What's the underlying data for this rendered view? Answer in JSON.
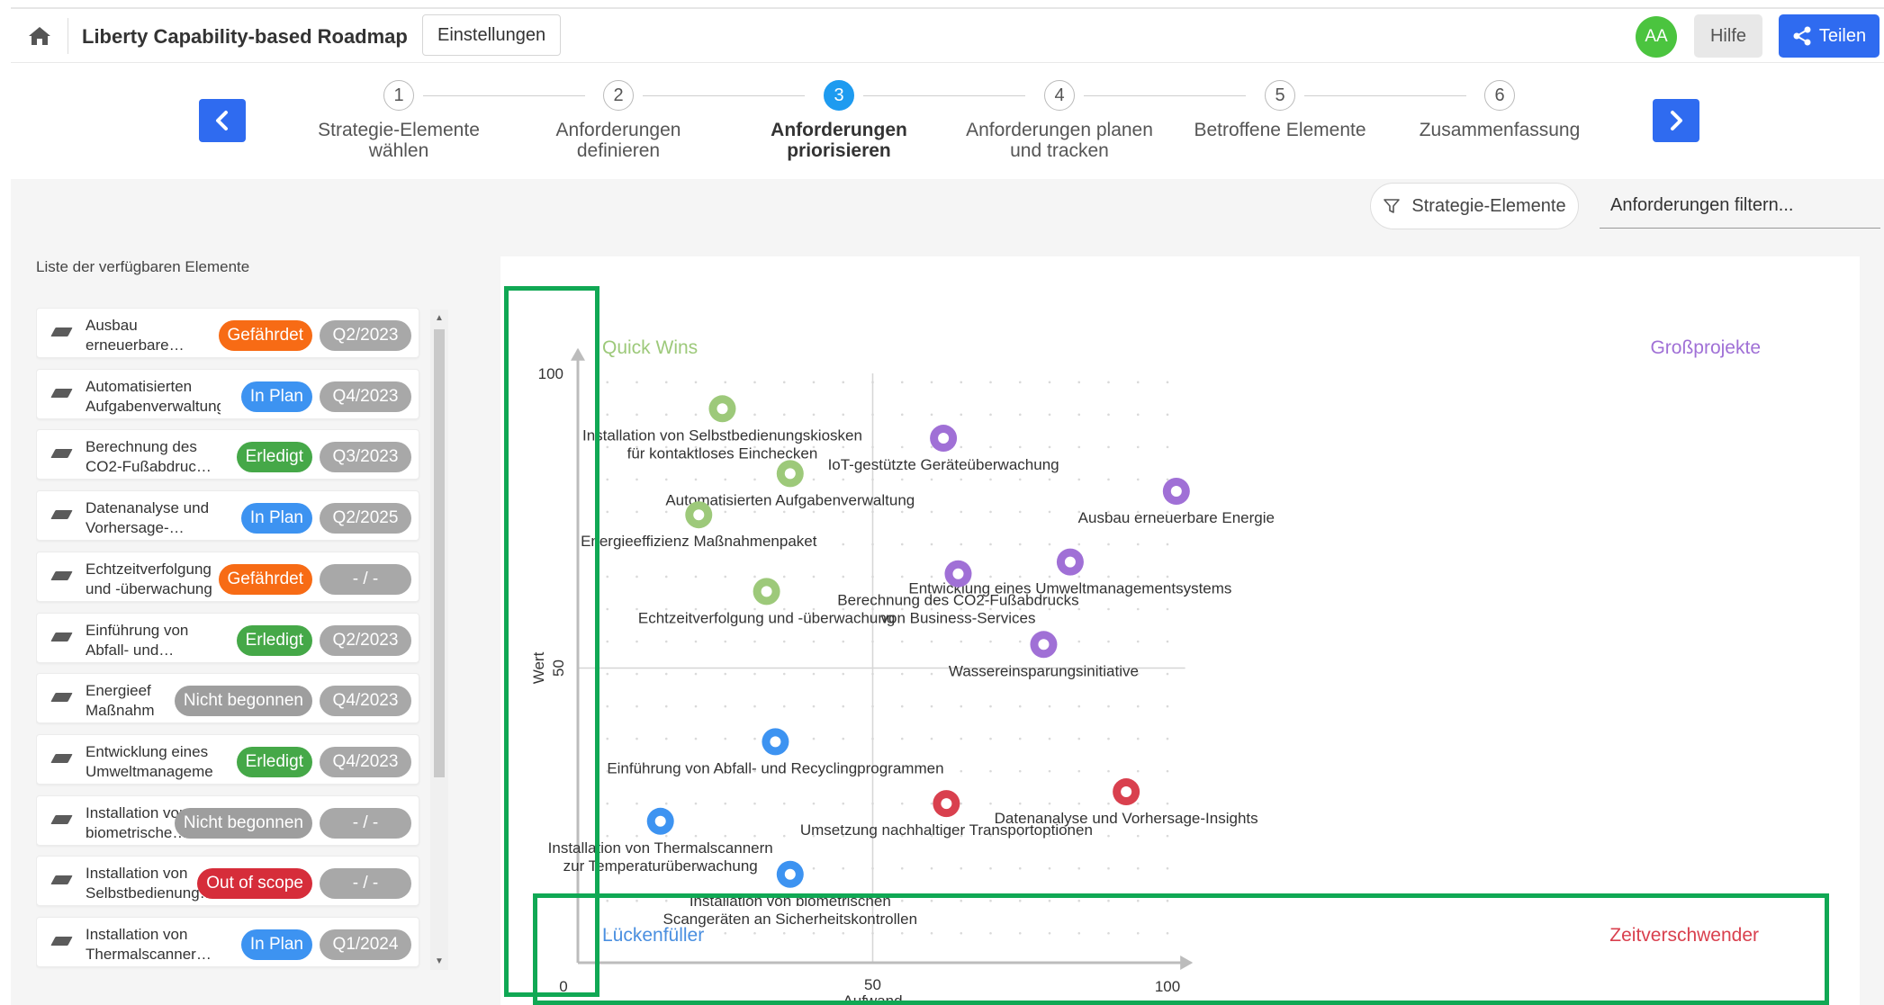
{
  "header": {
    "title": "Liberty Capability-based Roadmap",
    "settings_label": "Einstellungen",
    "avatar_initials": "AA",
    "help_label": "Hilfe",
    "share_label": "Teilen",
    "avatar_color": "#4bc43f",
    "accent_color": "#2f6bf0"
  },
  "stepper": {
    "steps": [
      {
        "num": "1",
        "label": "Strategie-Elemente\nwählen",
        "active": false
      },
      {
        "num": "2",
        "label": "Anforderungen\ndefinieren",
        "active": false
      },
      {
        "num": "3",
        "label": "Anforderungen\npriorisieren",
        "active": true
      },
      {
        "num": "4",
        "label": "Anforderungen planen\nund tracken",
        "active": false
      },
      {
        "num": "5",
        "label": "Betroffene Elemente",
        "active": false
      },
      {
        "num": "6",
        "label": "Zusammenfassung",
        "active": false
      }
    ]
  },
  "filters": {
    "strategy_label": "Strategie-Elemente",
    "search_placeholder": "Anforderungen filtern..."
  },
  "list": {
    "heading": "Liste der verfügbaren Elemente",
    "items": [
      {
        "name": "Ausbau\nerneuerbare…",
        "status": "Gefährdet",
        "status_color": "#f76b15",
        "quarter": "Q2/2023"
      },
      {
        "name": "Automatisierten\nAufgabenverwaltung",
        "status": "In Plan",
        "status_color": "#3d93f1",
        "quarter": "Q4/2023"
      },
      {
        "name": "Berechnung des\nCO2-Fußabdruc…",
        "status": "Erledigt",
        "status_color": "#45a848",
        "quarter": "Q3/2023"
      },
      {
        "name": "Datenanalyse und\nVorhersage-…",
        "status": "In Plan",
        "status_color": "#3d93f1",
        "quarter": "Q2/2025"
      },
      {
        "name": "Echtzeitverfolgung\nund -überwachung",
        "status": "Gefährdet",
        "status_color": "#f76b15",
        "quarter": "- / -"
      },
      {
        "name": "Einführung von\nAbfall- und…",
        "status": "Erledigt",
        "status_color": "#45a848",
        "quarter": "Q2/2023"
      },
      {
        "name": "Energieef\nMaßnahm",
        "status": "Nicht begonnen",
        "status_color": "#9e9e9e",
        "quarter": "Q4/2023"
      },
      {
        "name": "Entwicklung eines\nUmweltmanageme",
        "status": "Erledigt",
        "status_color": "#45a848",
        "quarter": "Q4/2023"
      },
      {
        "name": "Installation von\nbiometrische…",
        "status": "Nicht begonnen",
        "status_color": "#9e9e9e",
        "quarter": "- / -"
      },
      {
        "name": "Installation von\nSelbstbedienung…",
        "status": "Out of scope",
        "status_color": "#d62d3a",
        "quarter": "- / -"
      },
      {
        "name": "Installation von\nThermalscanner…",
        "status": "In Plan",
        "status_color": "#3d93f1",
        "quarter": "Q1/2024"
      }
    ]
  },
  "chart_data": {
    "type": "scatter",
    "xlabel": "Aufwand",
    "ylabel": "Wert",
    "xlim": [
      0,
      100
    ],
    "ylim": [
      0,
      100
    ],
    "x_ticks": [
      "0",
      "50",
      "100"
    ],
    "y_ticks": [
      "100",
      "50"
    ],
    "quadrants": {
      "top_left": {
        "label": "Quick Wins",
        "color": "#9dc97a"
      },
      "top_right": {
        "label": "Großprojekte",
        "color": "#a070d6"
      },
      "bottom_left": {
        "label": "Lückenfüller",
        "color": "#4a8fe0"
      },
      "bottom_right": {
        "label": "Zeitverschwender",
        "color": "#d9404e"
      }
    },
    "points": [
      {
        "label": "Installation von Selbstbedienungskiosken\nfür kontaktloses Einchecken",
        "x": 24.5,
        "y": 94,
        "color": "#9dc97a"
      },
      {
        "label": "Automatisierten Aufgabenverwaltung",
        "x": 36,
        "y": 83,
        "color": "#9dc97a"
      },
      {
        "label": "Energieeffizienz Maßnahmenpaket",
        "x": 20.5,
        "y": 76,
        "color": "#9dc97a"
      },
      {
        "label": "Echtzeitverfolgung und -überwachung",
        "x": 32,
        "y": 63,
        "color": "#9dc97a"
      },
      {
        "label": "IoT-gestützte Geräteüberwachung",
        "x": 62,
        "y": 89,
        "color": "#a070d6"
      },
      {
        "label": "Ausbau erneuerbare Energie",
        "x": 101.5,
        "y": 80,
        "color": "#a070d6"
      },
      {
        "label": "Entwicklung eines Umweltmanagementsystems",
        "x": 83.5,
        "y": 68,
        "color": "#a070d6"
      },
      {
        "label": "Berechnung des CO2-Fußabdrucks\nvon Business-Services",
        "x": 64.5,
        "y": 66,
        "color": "#a070d6"
      },
      {
        "label": "Wassereinsparungsinitiative",
        "x": 79,
        "y": 54,
        "color": "#a070d6"
      },
      {
        "label": "Einführung von Abfall- und Recyclingprogrammen",
        "x": 33.5,
        "y": 37.5,
        "color": "#3d93f1"
      },
      {
        "label": "Installation von Thermalscannern\nzur Temperaturüberwachung",
        "x": 14,
        "y": 24,
        "color": "#3d93f1"
      },
      {
        "label": "Installation von biometrischen\nScangeräten an Sicherheitskontrollen",
        "x": 36,
        "y": 15,
        "color": "#3d93f1"
      },
      {
        "label": "Umsetzung nachhaltiger Transportoptionen",
        "x": 62.5,
        "y": 27,
        "color": "#d9404e"
      },
      {
        "label": "Datenanalyse und Vorhersage-Insights",
        "x": 93,
        "y": 29,
        "color": "#d9404e"
      }
    ]
  }
}
